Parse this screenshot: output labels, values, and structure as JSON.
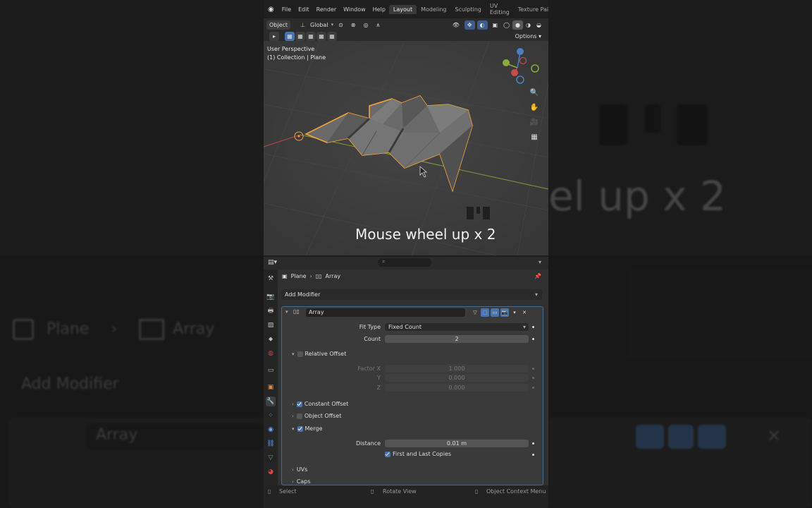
{
  "background": {
    "caption_ghost": "el up x 2",
    "breadcrumb_object": "Plane",
    "breadcrumb_modifier": "Array",
    "add_modifier": "Add Modifier",
    "modifier_name": "Array"
  },
  "menu": {
    "items": [
      "File",
      "Edit",
      "Render",
      "Window",
      "Help"
    ],
    "workspaces": [
      "Layout",
      "Modeling",
      "Sculpting",
      "UV Editing",
      "Texture Paint"
    ]
  },
  "viewport_header": {
    "mode": "Object",
    "orientation": "Global",
    "options": "Options"
  },
  "viewport": {
    "view_name": "User Perspective",
    "collection": "(1) Collection | Plane",
    "caption": "Mouse wheel up x 2"
  },
  "properties": {
    "breadcrumb_object": "Plane",
    "breadcrumb_modifier": "Array",
    "add_modifier": "Add Modifier",
    "modifier": {
      "name": "Array",
      "fit_type_label": "Fit Type",
      "fit_type_value": "Fixed Count",
      "count_label": "Count",
      "count_value": "2",
      "relative_offset": "Relative Offset",
      "factor_x_label": "Factor X",
      "factor_x": "1.000",
      "y_label": "Y",
      "y": "0.000",
      "z_label": "Z",
      "z": "0.000",
      "constant_offset": "Constant Offset",
      "object_offset": "Object Offset",
      "merge": "Merge",
      "distance_label": "Distance",
      "distance_value": "0.01 m",
      "first_last": "First and Last Copies",
      "uvs": "UVs",
      "caps": "Caps"
    }
  },
  "statusbar": {
    "select": "Select",
    "rotate": "Rotate View",
    "context": "Object Context Menu"
  },
  "colors": {
    "accent": "#4772b3",
    "selection_outline": "#f2a23a",
    "x_axis": "#b44a4a",
    "y_axis": "#7f9c3a"
  }
}
